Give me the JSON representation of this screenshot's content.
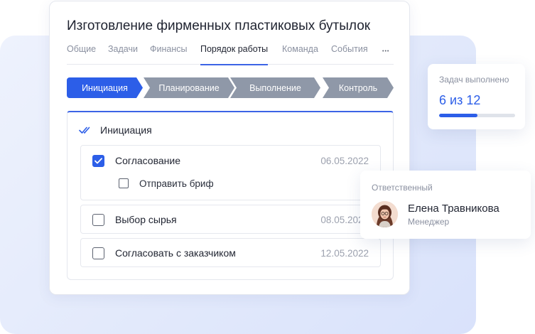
{
  "project": {
    "title": "Изготовление фирменных пластиковых бутылок"
  },
  "tabs": [
    {
      "label": "Общие",
      "active": false
    },
    {
      "label": "Задачи",
      "active": false
    },
    {
      "label": "Финансы",
      "active": false
    },
    {
      "label": "Порядок работы",
      "active": true
    },
    {
      "label": "Команда",
      "active": false
    },
    {
      "label": "События",
      "active": false
    }
  ],
  "tabs_more": "•••",
  "stages": [
    {
      "label": "Инициация",
      "active": true
    },
    {
      "label": "Планирование",
      "active": false
    },
    {
      "label": "Выполнение",
      "active": false
    },
    {
      "label": "Контроль",
      "active": false
    }
  ],
  "phase": {
    "title": "Инициация",
    "icon": "double-check-icon",
    "tasks": [
      {
        "name": "Согласование",
        "date": "06.05.2022",
        "checked": true,
        "subtasks": [
          {
            "name": "Отправить бриф",
            "checked": false
          }
        ]
      },
      {
        "name": "Выбор сырья",
        "date": "08.05.2022",
        "checked": false
      },
      {
        "name": "Согласовать с заказчиком",
        "date": "12.05.2022",
        "checked": false
      }
    ]
  },
  "stats": {
    "label": "Задач выполнено",
    "value": "6 из 12",
    "progress": 0.5
  },
  "responsible": {
    "label": "Ответственный",
    "name": "Елена Травникова",
    "role": "Менеджер"
  },
  "colors": {
    "accent": "#2c5ee8",
    "stage_inactive": "#8f98a8",
    "muted_text": "#8a90a0",
    "background_panel": "#e2e9fb"
  }
}
